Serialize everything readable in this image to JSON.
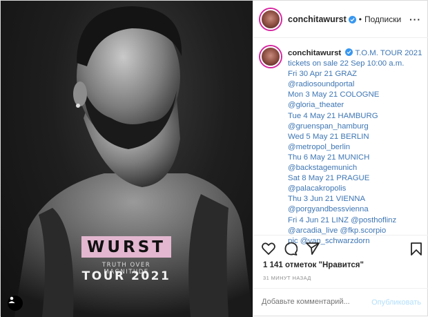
{
  "post": {
    "poster": {
      "title": "WURST",
      "subtitle": "TRUTH OVER MAGNITUDE",
      "tour": "TOUR 2021"
    },
    "icons": {
      "user_tag": "person-icon",
      "verified": "verified-badge-icon",
      "more": "more-icon",
      "like": "heart-icon",
      "comment": "comment-icon",
      "share": "share-icon",
      "save": "bookmark-icon"
    }
  },
  "header": {
    "username": "conchitawurst",
    "separator": "•",
    "follow_label": "Подписки",
    "more_label": "···"
  },
  "caption": {
    "username": "conchitawurst",
    "lines": [
      "T.O.M. TOUR 2021",
      "tickets on sale 22 Sep 10:00 a.m.",
      "Fri 30 Apr 21 GRAZ",
      "@radiosoundportal",
      "Mon 3 May 21 COLOGNE",
      "@gloria_theater",
      "Tue 4 May 21 HAMBURG",
      "@gruenspan_hamburg",
      "Wed 5 May 21 BERLIN",
      "@metropol_berlin",
      "Thu 6 May 21 MUNICH",
      "@backstagemunich",
      "Sat 8 May 21 PRAGUE",
      "@palacakropolis",
      "Thu 3 Jun 21 VIENNA",
      "@porgyandbessvienna",
      "Fri 4 Jun 21 LINZ @posthoflinz",
      "@arcadia_live @fkp.scorpio",
      "pic @van_schwarzdorn"
    ]
  },
  "stats": {
    "likes": "1 141 отметок \"Нравится\"",
    "time": "31 МИНУТ НАЗАД"
  },
  "comment": {
    "placeholder": "Добавьте комментарий...",
    "publish_label": "Опубликовать"
  },
  "colors": {
    "poster_pink": "#e3b7d0",
    "link_blue": "#3e76b4",
    "verified_blue": "#3897f0",
    "publish_disabled": "#b2dffc"
  }
}
